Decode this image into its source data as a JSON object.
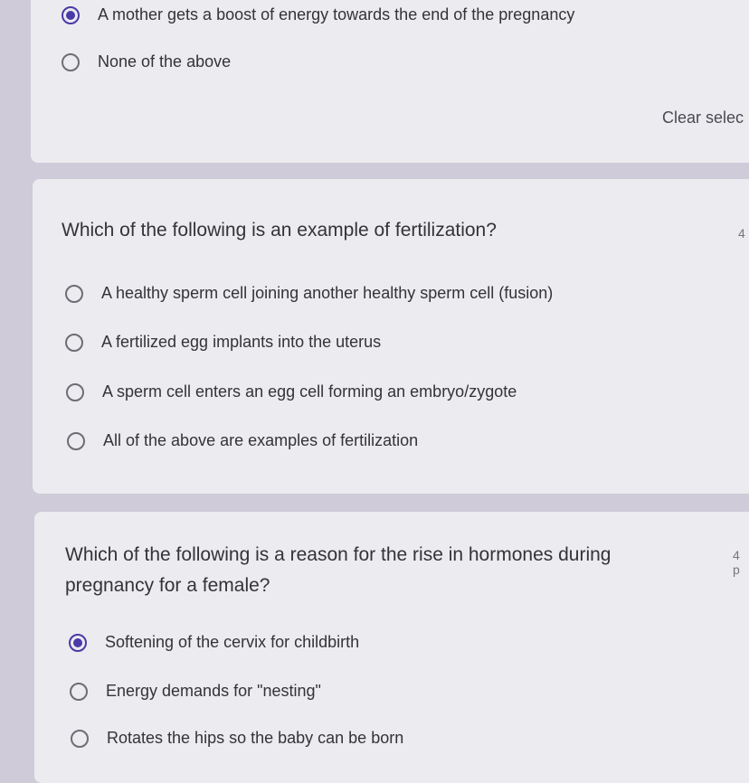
{
  "question1": {
    "options": [
      {
        "label": "A mother gets a boost of energy towards the end of the pregnancy",
        "selected": true
      },
      {
        "label": "None of the above",
        "selected": false
      }
    ],
    "clear_label": "Clear selec"
  },
  "question2": {
    "title": "Which of the following is an example of fertilization?",
    "points": "4",
    "options": [
      {
        "label": "A healthy sperm cell joining another healthy sperm cell (fusion)",
        "selected": false
      },
      {
        "label": "A fertilized egg implants into the uterus",
        "selected": false
      },
      {
        "label": "A sperm cell enters an egg cell forming an embryo/zygote",
        "selected": false
      },
      {
        "label": "All of the above are examples of fertilization",
        "selected": false
      }
    ]
  },
  "question3": {
    "title_line1": "Which of the following is a reason for the rise in hormones during",
    "title_line2": "pregnancy for a female?",
    "points": "4 p",
    "options": [
      {
        "label": "Softening of the cervix for childbirth",
        "selected": true
      },
      {
        "label": "Energy demands for \"nesting\"",
        "selected": false
      },
      {
        "label": "Rotates the hips so the baby can be born",
        "selected": false
      }
    ]
  },
  "colors": {
    "accent": "#4a3aa8",
    "card": "#ecebef",
    "background": "#cfcbd8"
  }
}
